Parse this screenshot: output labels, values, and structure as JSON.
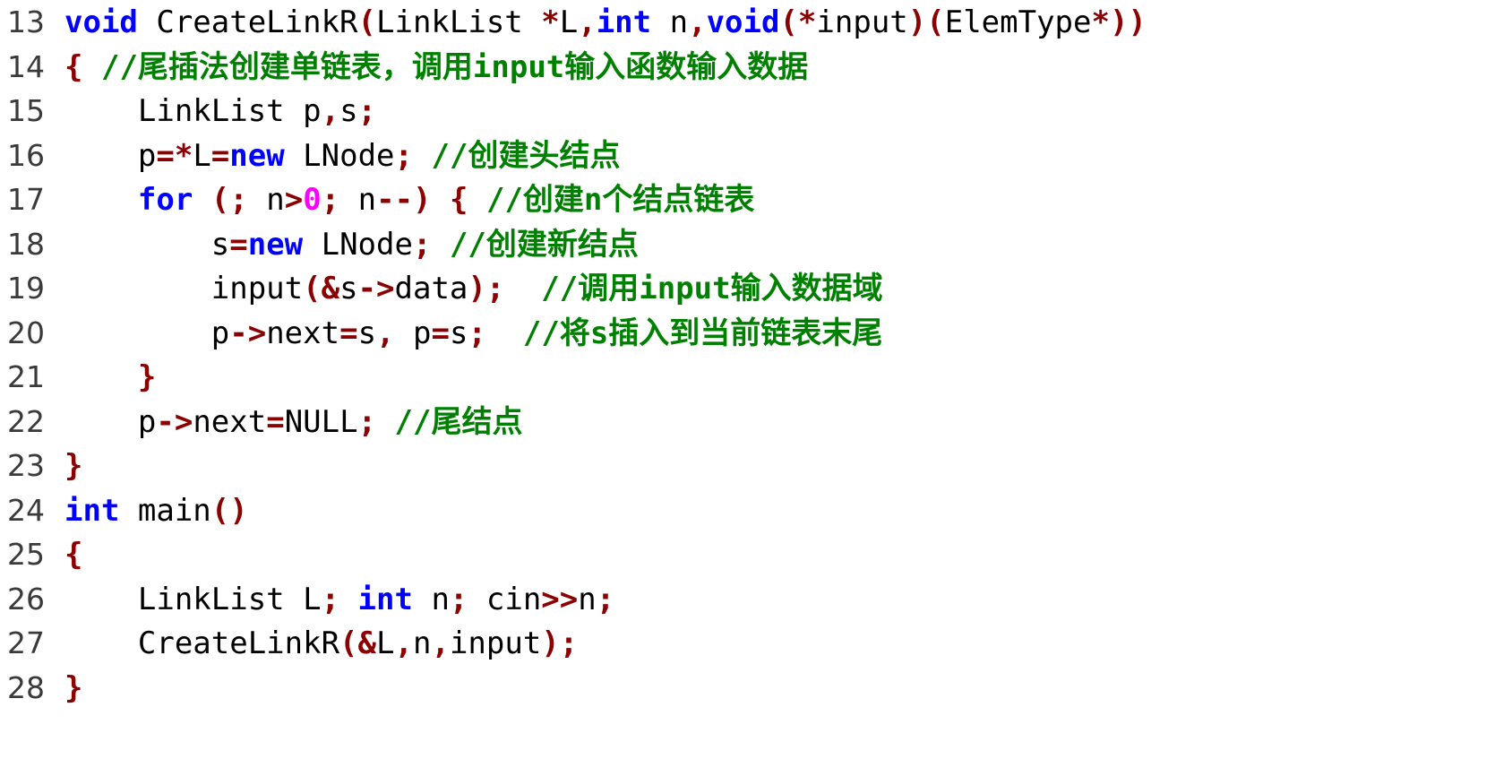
{
  "editor": {
    "language": "C++",
    "background_color": "#ffffff",
    "gutter_color": "#3a3a3a",
    "palette": {
      "keyword": "#0000ff",
      "punctuation": "#8b0000",
      "comment": "#008000",
      "number": "#ff00ff",
      "identifier": "#000000"
    },
    "first_line_number": 13,
    "last_line_number": 28,
    "lines": [
      {
        "number": "13",
        "text": "void CreateLinkR(LinkList *L,int n,void(*input)(ElemType*))",
        "tokens": [
          {
            "t": "void",
            "k": "kw"
          },
          {
            "t": " CreateLinkR",
            "k": "plain"
          },
          {
            "t": "(",
            "k": "punct"
          },
          {
            "t": "LinkList ",
            "k": "plain"
          },
          {
            "t": "*",
            "k": "punct"
          },
          {
            "t": "L",
            "k": "plain"
          },
          {
            "t": ",",
            "k": "punct"
          },
          {
            "t": "int",
            "k": "kw"
          },
          {
            "t": " n",
            "k": "plain"
          },
          {
            "t": ",",
            "k": "punct"
          },
          {
            "t": "void",
            "k": "kw"
          },
          {
            "t": "(*",
            "k": "punct"
          },
          {
            "t": "input",
            "k": "plain"
          },
          {
            "t": ")(",
            "k": "punct"
          },
          {
            "t": "ElemType",
            "k": "plain"
          },
          {
            "t": "*))",
            "k": "punct"
          }
        ]
      },
      {
        "number": "14",
        "text": "{ //尾插法创建单链表，调用input输入函数输入数据",
        "tokens": [
          {
            "t": "{",
            "k": "punct"
          },
          {
            "t": " ",
            "k": "plain"
          },
          {
            "t": "//尾插法创建单链表，调用input输入函数输入数据",
            "k": "comment"
          }
        ]
      },
      {
        "number": "15",
        "text": "    LinkList p,s;",
        "tokens": [
          {
            "t": "    LinkList p",
            "k": "plain"
          },
          {
            "t": ",",
            "k": "punct"
          },
          {
            "t": "s",
            "k": "plain"
          },
          {
            "t": ";",
            "k": "punct"
          }
        ]
      },
      {
        "number": "16",
        "text": "    p=*L=new LNode; //创建头结点",
        "tokens": [
          {
            "t": "    p",
            "k": "plain"
          },
          {
            "t": "=*",
            "k": "punct"
          },
          {
            "t": "L",
            "k": "plain"
          },
          {
            "t": "=",
            "k": "punct"
          },
          {
            "t": "new",
            "k": "kw"
          },
          {
            "t": " LNode",
            "k": "plain"
          },
          {
            "t": ";",
            "k": "punct"
          },
          {
            "t": " ",
            "k": "plain"
          },
          {
            "t": "//创建头结点",
            "k": "comment"
          }
        ]
      },
      {
        "number": "17",
        "text": "    for (; n>0; n--) { //创建n个结点链表",
        "tokens": [
          {
            "t": "    ",
            "k": "plain"
          },
          {
            "t": "for",
            "k": "kw"
          },
          {
            "t": " ",
            "k": "plain"
          },
          {
            "t": "(;",
            "k": "punct"
          },
          {
            "t": " n",
            "k": "plain"
          },
          {
            "t": ">",
            "k": "punct"
          },
          {
            "t": "0",
            "k": "num"
          },
          {
            "t": ";",
            "k": "punct"
          },
          {
            "t": " n",
            "k": "plain"
          },
          {
            "t": "--)",
            "k": "punct"
          },
          {
            "t": " ",
            "k": "plain"
          },
          {
            "t": "{",
            "k": "punct"
          },
          {
            "t": " ",
            "k": "plain"
          },
          {
            "t": "//创建n个结点链表",
            "k": "comment"
          }
        ]
      },
      {
        "number": "18",
        "text": "        s=new LNode; //创建新结点",
        "tokens": [
          {
            "t": "        s",
            "k": "plain"
          },
          {
            "t": "=",
            "k": "punct"
          },
          {
            "t": "new",
            "k": "kw"
          },
          {
            "t": " LNode",
            "k": "plain"
          },
          {
            "t": ";",
            "k": "punct"
          },
          {
            "t": " ",
            "k": "plain"
          },
          {
            "t": "//创建新结点",
            "k": "comment"
          }
        ]
      },
      {
        "number": "19",
        "text": "        input(&s->data); //调用input输入数据域",
        "tokens": [
          {
            "t": "        input",
            "k": "plain"
          },
          {
            "t": "(&",
            "k": "punct"
          },
          {
            "t": "s",
            "k": "plain"
          },
          {
            "t": "->",
            "k": "punct"
          },
          {
            "t": "data",
            "k": "plain"
          },
          {
            "t": ");",
            "k": "punct"
          },
          {
            "t": "  ",
            "k": "plain"
          },
          {
            "t": "//调用input输入数据域",
            "k": "comment"
          }
        ]
      },
      {
        "number": "20",
        "text": "        p->next=s, p=s; //将s插入到当前链表末尾",
        "tokens": [
          {
            "t": "        p",
            "k": "plain"
          },
          {
            "t": "->",
            "k": "punct"
          },
          {
            "t": "next",
            "k": "plain"
          },
          {
            "t": "=",
            "k": "punct"
          },
          {
            "t": "s",
            "k": "plain"
          },
          {
            "t": ",",
            "k": "punct"
          },
          {
            "t": " p",
            "k": "plain"
          },
          {
            "t": "=",
            "k": "punct"
          },
          {
            "t": "s",
            "k": "plain"
          },
          {
            "t": ";",
            "k": "punct"
          },
          {
            "t": "  ",
            "k": "plain"
          },
          {
            "t": "//将s插入到当前链表末尾",
            "k": "comment"
          }
        ]
      },
      {
        "number": "21",
        "text": "    }",
        "tokens": [
          {
            "t": "    ",
            "k": "plain"
          },
          {
            "t": "}",
            "k": "punct"
          }
        ]
      },
      {
        "number": "22",
        "text": "    p->next=NULL; //尾结点",
        "tokens": [
          {
            "t": "    p",
            "k": "plain"
          },
          {
            "t": "->",
            "k": "punct"
          },
          {
            "t": "next",
            "k": "plain"
          },
          {
            "t": "=",
            "k": "punct"
          },
          {
            "t": "NULL",
            "k": "plain"
          },
          {
            "t": ";",
            "k": "punct"
          },
          {
            "t": " ",
            "k": "plain"
          },
          {
            "t": "//尾结点",
            "k": "comment"
          }
        ]
      },
      {
        "number": "23",
        "text": "}",
        "tokens": [
          {
            "t": "}",
            "k": "punct"
          }
        ]
      },
      {
        "number": "24",
        "text": "int main()",
        "tokens": [
          {
            "t": "int",
            "k": "kw"
          },
          {
            "t": " main",
            "k": "plain"
          },
          {
            "t": "()",
            "k": "punct"
          }
        ]
      },
      {
        "number": "25",
        "text": "{",
        "tokens": [
          {
            "t": "{",
            "k": "punct"
          }
        ]
      },
      {
        "number": "26",
        "text": "    LinkList L; int n; cin>>n;",
        "tokens": [
          {
            "t": "    LinkList L",
            "k": "plain"
          },
          {
            "t": ";",
            "k": "punct"
          },
          {
            "t": " ",
            "k": "plain"
          },
          {
            "t": "int",
            "k": "kw"
          },
          {
            "t": " n",
            "k": "plain"
          },
          {
            "t": ";",
            "k": "punct"
          },
          {
            "t": " cin",
            "k": "plain"
          },
          {
            "t": ">>",
            "k": "punct"
          },
          {
            "t": "n",
            "k": "plain"
          },
          {
            "t": ";",
            "k": "punct"
          }
        ]
      },
      {
        "number": "27",
        "text": "    CreateLinkR(&L,n,input);",
        "tokens": [
          {
            "t": "    CreateLinkR",
            "k": "plain"
          },
          {
            "t": "(&",
            "k": "punct"
          },
          {
            "t": "L",
            "k": "plain"
          },
          {
            "t": ",",
            "k": "punct"
          },
          {
            "t": "n",
            "k": "plain"
          },
          {
            "t": ",",
            "k": "punct"
          },
          {
            "t": "input",
            "k": "plain"
          },
          {
            "t": ");",
            "k": "punct"
          }
        ]
      },
      {
        "number": "28",
        "text": "}",
        "tokens": [
          {
            "t": "}",
            "k": "punct"
          }
        ]
      }
    ]
  }
}
